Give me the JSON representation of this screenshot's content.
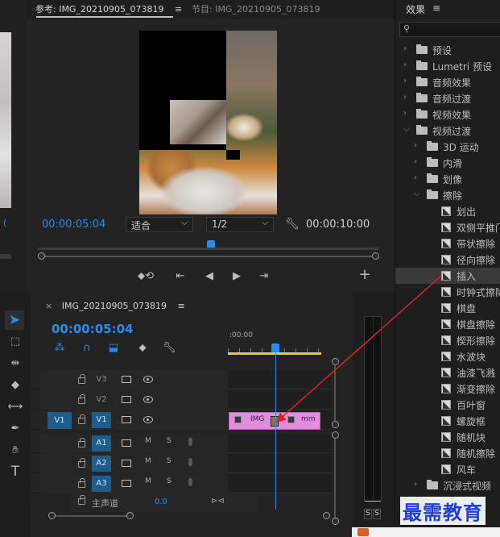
{
  "source_monitor": {
    "tab_label": "参考: IMG_20210905_073819",
    "program_tab_label": "节目: IMG_20210905_073819"
  },
  "program_monitor": {
    "current_timecode": "00:00:05:04",
    "fit_select": "适合",
    "resolution_select": "1/2",
    "duration_timecode": "00:00:10:00"
  },
  "effects_panel": {
    "title": "效果",
    "items": [
      {
        "label": "预设",
        "type": "folder-star",
        "indent": 0,
        "expanded": false
      },
      {
        "label": "Lumetri 预设",
        "type": "folder-star",
        "indent": 0,
        "expanded": false
      },
      {
        "label": "音频效果",
        "type": "folder",
        "indent": 0,
        "expanded": false
      },
      {
        "label": "音频过渡",
        "type": "folder",
        "indent": 0,
        "expanded": false
      },
      {
        "label": "视频效果",
        "type": "folder",
        "indent": 0,
        "expanded": false
      },
      {
        "label": "视频过渡",
        "type": "folder",
        "indent": 0,
        "expanded": true
      },
      {
        "label": "3D 运动",
        "type": "folder",
        "indent": 1,
        "expanded": false
      },
      {
        "label": "内滑",
        "type": "folder",
        "indent": 1,
        "expanded": false
      },
      {
        "label": "划像",
        "type": "folder",
        "indent": 1,
        "expanded": false
      },
      {
        "label": "擦除",
        "type": "folder",
        "indent": 1,
        "expanded": true
      },
      {
        "label": "划出",
        "type": "effect",
        "indent": 2
      },
      {
        "label": "双侧平推门",
        "type": "effect",
        "indent": 2
      },
      {
        "label": "带状擦除",
        "type": "effect",
        "indent": 2
      },
      {
        "label": "径向擦除",
        "type": "effect",
        "indent": 2
      },
      {
        "label": "插入",
        "type": "effect",
        "indent": 2,
        "selected": true
      },
      {
        "label": "时钟式擦除",
        "type": "effect",
        "indent": 2
      },
      {
        "label": "棋盘",
        "type": "effect",
        "indent": 2
      },
      {
        "label": "棋盘擦除",
        "type": "effect",
        "indent": 2
      },
      {
        "label": "楔形擦除",
        "type": "effect",
        "indent": 2
      },
      {
        "label": "水波块",
        "type": "effect",
        "indent": 2
      },
      {
        "label": "油漆飞溅",
        "type": "effect",
        "indent": 2
      },
      {
        "label": "渐变擦除",
        "type": "effect",
        "indent": 2
      },
      {
        "label": "百叶窗",
        "type": "effect",
        "indent": 2
      },
      {
        "label": "螺旋框",
        "type": "effect",
        "indent": 2
      },
      {
        "label": "随机块",
        "type": "effect",
        "indent": 2
      },
      {
        "label": "随机擦除",
        "type": "effect",
        "indent": 2
      },
      {
        "label": "风车",
        "type": "effect",
        "indent": 2
      },
      {
        "label": "沉浸式视频",
        "type": "folder",
        "indent": 1,
        "expanded": false
      }
    ]
  },
  "timeline": {
    "sequence_tab": "IMG_20210905_073819",
    "timecode": "00:00:05:04",
    "ruler_start": ":00:00",
    "video_tracks": [
      {
        "name": "V3",
        "source": ""
      },
      {
        "name": "V2",
        "source": ""
      },
      {
        "name": "V1",
        "source": "V1"
      }
    ],
    "audio_tracks": [
      {
        "name": "A1",
        "m": "M",
        "s": "S"
      },
      {
        "name": "A2",
        "m": "M",
        "s": "S"
      },
      {
        "name": "A3",
        "m": "M",
        "s": "S"
      }
    ],
    "master": {
      "label": "主声道",
      "value": "0.0"
    },
    "clip_left_label": "IMG",
    "clip_right_label": "mm"
  },
  "audio_meter": {
    "s_left": "S",
    "s_right": "S"
  },
  "watermark": "最需教育",
  "colors": {
    "accent_blue": "#2d8ceb",
    "clip_pink": "#e28de0",
    "track_select": "#1e5c8c",
    "work_area": "#e6d030",
    "arrow_red": "#d82424"
  }
}
